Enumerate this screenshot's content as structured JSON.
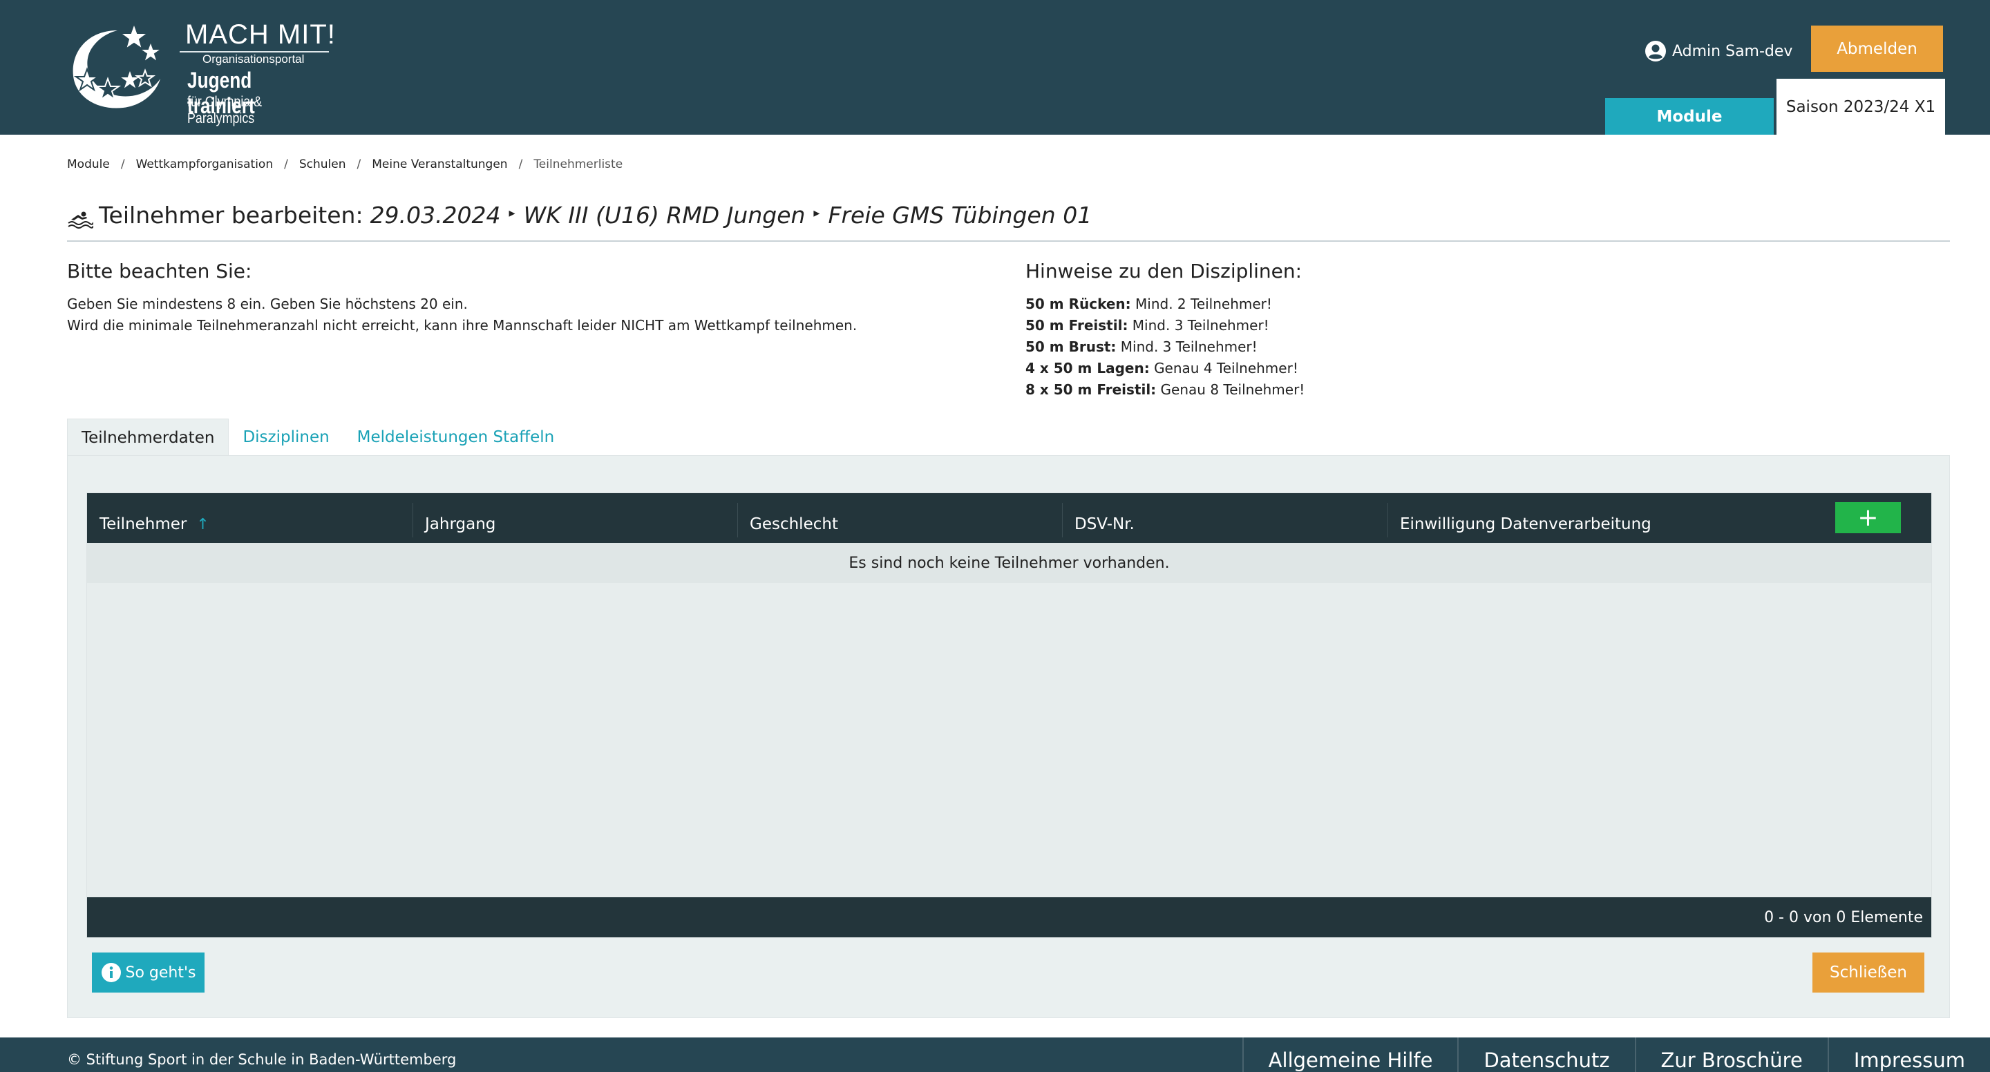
{
  "header": {
    "logo_title": "MACH MIT!",
    "logo_sub": "Organisationsportal",
    "logo_main": "Jugend trainiert",
    "logo_tag": "für Olympia & Paralympics",
    "user_name": "Admin Sam-dev",
    "logout_label": "Abmelden",
    "module_tab": "Module",
    "season_tab": "Saison 2023/24 X1",
    "bg_color": "#264653"
  },
  "breadcrumb": [
    "Module",
    "Wettkampforganisation",
    "Schulen",
    "Meine Veranstaltungen",
    "Teilnehmerliste"
  ],
  "breadcrumb_sep": "/",
  "title": {
    "prefix": "Teilnehmer bearbeiten:",
    "date": "29.03.2024",
    "competition": "WK III (U16) RMD Jungen",
    "team": "Freie GMS Tübingen 01",
    "separator": "▸"
  },
  "notes": {
    "heading": "Bitte beachten Sie:",
    "lines": [
      "Geben Sie mindestens 8 ein. Geben Sie höchstens 20 ein.",
      "Wird die minimale Teilnehmeranzahl nicht erreicht, kann ihre Mannschaft leider NICHT am Wettkampf teilnehmen."
    ]
  },
  "disciplines": {
    "heading": "Hinweise zu den Disziplinen:",
    "items": [
      {
        "name": "50 m Rücken:",
        "rule": "Mind. 2 Teilnehmer!"
      },
      {
        "name": "50 m Freistil:",
        "rule": "Mind. 3 Teilnehmer!"
      },
      {
        "name": "50 m Brust:",
        "rule": "Mind. 3 Teilnehmer!"
      },
      {
        "name": "4 x 50 m Lagen:",
        "rule": "Genau 4 Teilnehmer!"
      },
      {
        "name": "8 x 50 m Freistil:",
        "rule": "Genau 8 Teilnehmer!"
      }
    ]
  },
  "tabs": [
    "Teilnehmerdaten",
    "Disziplinen",
    "Meldeleistungen Staffeln"
  ],
  "grid": {
    "columns": [
      "Teilnehmer",
      "Jahrgang",
      "Geschlecht",
      "DSV-Nr.",
      "Einwilligung Datenverarbeitung"
    ],
    "sort_indicator": "↑",
    "add_label": "+",
    "empty_message": "Es sind noch keine Teilnehmer vorhanden.",
    "pager": "0 - 0 von 0 Elemente"
  },
  "buttons": {
    "howto": "So geht's",
    "close": "Schließen"
  },
  "footer": {
    "copyright": "© Stiftung Sport in der Schule in Baden-Württemberg",
    "links": [
      "Allgemeine Hilfe",
      "Datenschutz",
      "Zur Broschüre",
      "Impressum"
    ]
  },
  "colors": {
    "header": "#264653",
    "accent_orange": "#e9a03a",
    "accent_teal": "#1fa9bd",
    "add_green": "#22b44a",
    "grid_dark": "#23353b"
  }
}
